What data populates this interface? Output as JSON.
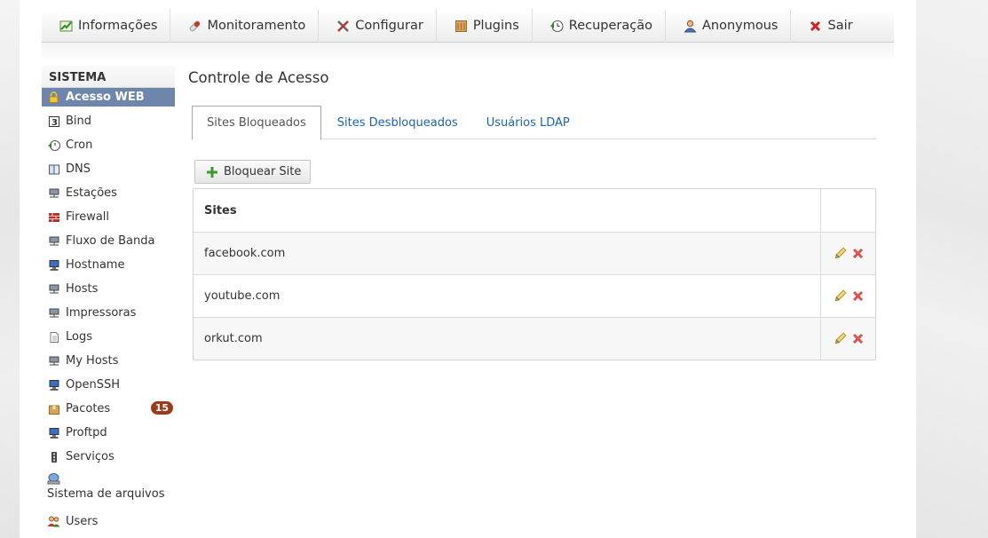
{
  "topnav": {
    "items": [
      {
        "label": "Informações",
        "icon": "chart-up-icon"
      },
      {
        "label": "Monitoramento",
        "icon": "pill-icon"
      },
      {
        "label": "Configurar",
        "icon": "tools-icon"
      },
      {
        "label": "Plugins",
        "icon": "box-icon"
      },
      {
        "label": "Recuperação",
        "icon": "restore-clock-icon"
      },
      {
        "label": "Anonymous",
        "icon": "user-icon"
      },
      {
        "label": "Sair",
        "icon": "close-icon"
      }
    ]
  },
  "sidebar": {
    "title": "SISTEMA",
    "items": [
      {
        "label": "Acesso WEB",
        "icon": "lock-icon",
        "active": true
      },
      {
        "label": "Bind",
        "icon": "bind-icon"
      },
      {
        "label": "Cron",
        "icon": "clock-arrow-icon"
      },
      {
        "label": "DNS",
        "icon": "book-icon"
      },
      {
        "label": "Estações",
        "icon": "network-icon"
      },
      {
        "label": "Firewall",
        "icon": "brick-wall-icon"
      },
      {
        "label": "Fluxo de Banda",
        "icon": "network-icon"
      },
      {
        "label": "Hostname",
        "icon": "computer-icon"
      },
      {
        "label": "Hosts",
        "icon": "network-icon"
      },
      {
        "label": "Impressoras",
        "icon": "network-icon"
      },
      {
        "label": "Logs",
        "icon": "document-icon"
      },
      {
        "label": "My Hosts",
        "icon": "network-icon"
      },
      {
        "label": "OpenSSH",
        "icon": "computer-icon"
      },
      {
        "label": "Pacotes",
        "icon": "package-icon",
        "badge": "15"
      },
      {
        "label": "Proftpd",
        "icon": "computer-icon"
      },
      {
        "label": "Serviços",
        "icon": "traffic-light-icon"
      },
      {
        "label": "Sistema de arquivos",
        "icon": "disk-icon"
      },
      {
        "label": "Users",
        "icon": "users-icon"
      }
    ]
  },
  "main": {
    "title": "Controle de Acesso",
    "tabs": [
      {
        "label": "Sites Bloqueados",
        "active": true
      },
      {
        "label": "Sites Desbloqueados",
        "active": false
      },
      {
        "label": "Usuários LDAP",
        "active": false
      }
    ],
    "action_button": "Bloquear Site",
    "table": {
      "header": "Sites",
      "rows": [
        "facebook.com",
        "youtube.com",
        "orkut.com"
      ]
    }
  },
  "colors": {
    "accent_active": "#6e86ac",
    "link": "#1a63b0",
    "badge": "#9c3b1c",
    "delete": "#d9534f"
  }
}
